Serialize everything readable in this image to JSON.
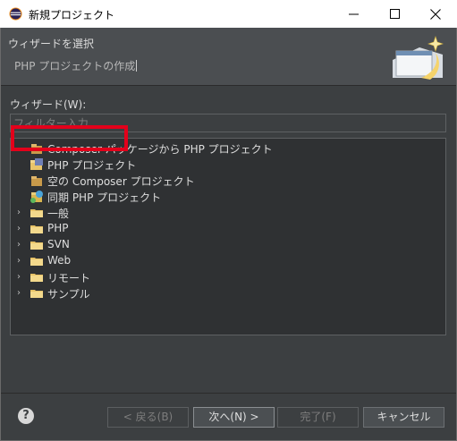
{
  "window": {
    "title": "新規プロジェクト",
    "controls": {
      "minimize": "—",
      "maximize": "☐",
      "close": "✕"
    }
  },
  "header": {
    "title": "ウィザードを選択",
    "description": "PHP プロジェクトの作成"
  },
  "wizard_label": "ウィザード(W):",
  "filter": {
    "placeholder": "フィルター入力",
    "value": ""
  },
  "tree": {
    "items": [
      {
        "label": "Composer パッケージから PHP プロジェクト",
        "icon": "composer-project-icon",
        "expandable": false
      },
      {
        "label": "PHP プロジェクト",
        "icon": "php-project-icon",
        "expandable": false,
        "highlighted": true
      },
      {
        "label": "空の Composer プロジェクト",
        "icon": "composer-project-icon",
        "expandable": false
      },
      {
        "label": "同期 PHP プロジェクト",
        "icon": "sync-project-icon",
        "expandable": false
      },
      {
        "label": "一般",
        "icon": "folder-icon",
        "expandable": true
      },
      {
        "label": "PHP",
        "icon": "folder-icon",
        "expandable": true
      },
      {
        "label": "SVN",
        "icon": "folder-icon",
        "expandable": true
      },
      {
        "label": "Web",
        "icon": "folder-icon",
        "expandable": true
      },
      {
        "label": "リモート",
        "icon": "folder-icon",
        "expandable": true
      },
      {
        "label": "サンプル",
        "icon": "folder-icon",
        "expandable": true
      }
    ]
  },
  "footer": {
    "help": "?",
    "back": "< 戻る(B)",
    "next": "次へ(N) >",
    "finish": "完了(F)",
    "cancel": "キャンセル"
  },
  "colors": {
    "highlight": "#e3001b",
    "dialog_bg": "#3c3f41",
    "tree_bg": "#2f3133"
  }
}
